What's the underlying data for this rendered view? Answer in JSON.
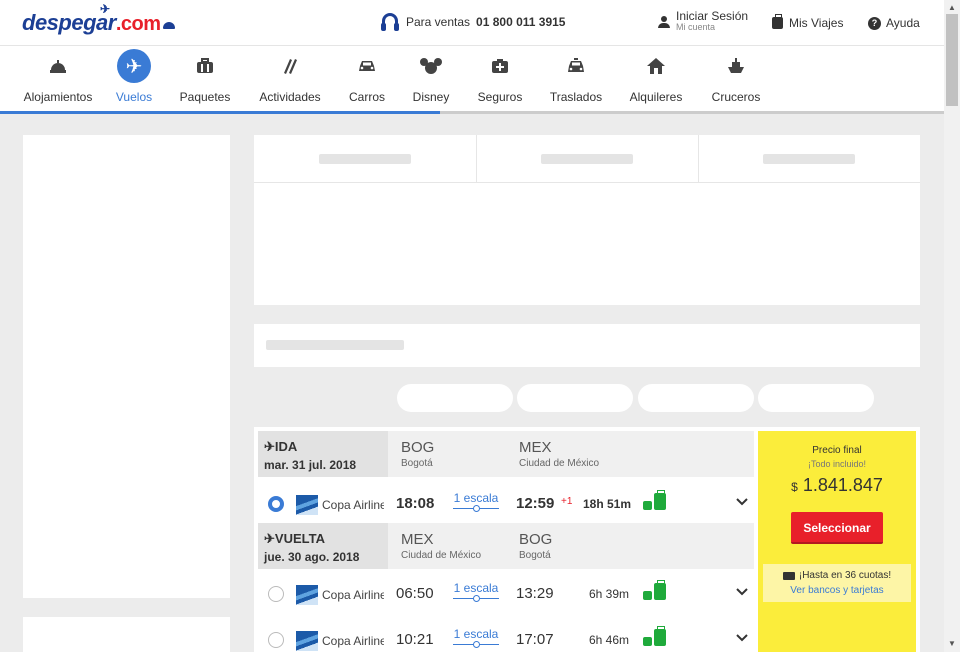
{
  "header": {
    "logo_text": "despegar",
    "logo_dotcom": ".com",
    "phone_label": "Para ventas",
    "phone_number": "01 800 011 3915",
    "login_title": "Iniciar Sesión",
    "login_sub": "Mi cuenta",
    "trips": "Mis Viajes",
    "help": "Ayuda"
  },
  "nav": [
    {
      "label": "Alojamientos",
      "icon": "hotel-bell-icon",
      "glyph": "🛎"
    },
    {
      "label": "Vuelos",
      "icon": "plane-icon",
      "glyph": "✈",
      "active": true
    },
    {
      "label": "Paquetes",
      "icon": "suitcase-icon",
      "glyph": "💼"
    },
    {
      "label": "Actividades",
      "icon": "activities-icon",
      "glyph": "🎫"
    },
    {
      "label": "Carros",
      "icon": "car-icon",
      "glyph": "🚗"
    },
    {
      "label": "Disney",
      "icon": "disney-icon",
      "glyph": "🐭"
    },
    {
      "label": "Seguros",
      "icon": "insurance-icon",
      "glyph": "🩹"
    },
    {
      "label": "Traslados",
      "icon": "taxi-icon",
      "glyph": "🚕"
    },
    {
      "label": "Alquileres",
      "icon": "house-icon",
      "glyph": "🏠"
    },
    {
      "label": "Cruceros",
      "icon": "ship-icon",
      "glyph": "🚢"
    }
  ],
  "outbound": {
    "direction": "IDA",
    "date": "mar. 31 jul. 2018",
    "from_code": "BOG",
    "from_city": "Bogotá",
    "to_code": "MEX",
    "to_city": "Ciudad de México"
  },
  "inbound": {
    "direction": "VUELTA",
    "date": "jue. 30 ago. 2018",
    "from_code": "MEX",
    "from_city": "Ciudad de México",
    "to_code": "BOG",
    "to_city": "Bogotá"
  },
  "flights": [
    {
      "airline": "Copa Airlines",
      "dep": "18:08",
      "stops": "1 escala",
      "arr": "12:59",
      "plus": "+1",
      "duration": "18h 51m",
      "selected": true
    },
    {
      "airline": "Copa Airlines",
      "dep": "06:50",
      "stops": "1 escala",
      "arr": "13:29",
      "duration": "6h 39m",
      "selected": false
    },
    {
      "airline": "Copa Airlines",
      "dep": "10:21",
      "stops": "1 escala",
      "arr": "17:07",
      "duration": "6h 46m",
      "selected": false
    }
  ],
  "price": {
    "label": "Precio final",
    "included": "¡Todo incluido!",
    "currency": "$",
    "amount": "1.841.847",
    "button": "Seleccionar",
    "installments": "¡Hasta en 36 cuotas!",
    "banks_link": "Ver bancos y tarjetas"
  },
  "colors": {
    "brand_blue": "#1c3f95",
    "accent_blue": "#3a7bd5",
    "price_bg": "#fbed3b",
    "cta_red": "#e8202a",
    "luggage_green": "#1faa3b"
  }
}
